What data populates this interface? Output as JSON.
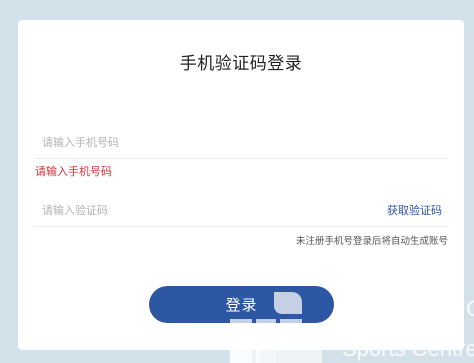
{
  "page": {
    "title": "手机验证码登录"
  },
  "phone": {
    "placeholder": "请输入手机号码",
    "value": "",
    "error": "请输入手机号码"
  },
  "code": {
    "placeholder": "请输入验证码",
    "value": "",
    "get_code_label": "获取验证码"
  },
  "hint": "未注册手机号登录后将自动生成账号",
  "login_button": "登录",
  "background": {
    "watermark_text": "Sports Centre",
    "watermark_text_2": "C"
  },
  "colors": {
    "background": "#d3e2ea",
    "primary": "#2e57a3",
    "error": "#d0343a",
    "link": "#2c55a6"
  }
}
